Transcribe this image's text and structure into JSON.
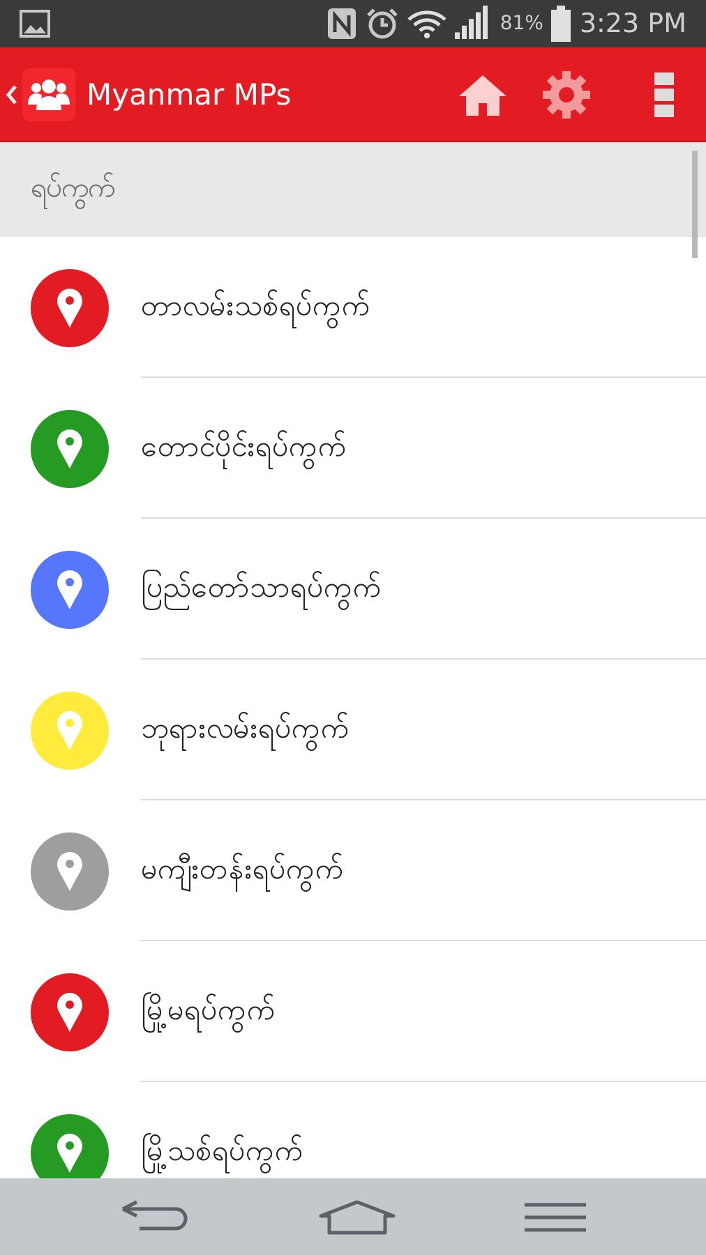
{
  "status_bar": {
    "battery": "81%",
    "time": "3:23 PM"
  },
  "app_bar": {
    "title": "Myanmar MPs"
  },
  "section_header": "ရပ်ကွက်",
  "items": [
    {
      "label": "တာလမ်းသစ်ရပ်ကွက်",
      "color": "#e31b23"
    },
    {
      "label": "တောင်ပိုင်းရပ်ကွက်",
      "color": "#259b24"
    },
    {
      "label": "ပြည်တော်သာရပ်ကွက်",
      "color": "#5677fc"
    },
    {
      "label": "ဘုရားလမ်းရပ်ကွက်",
      "color": "#ffeb3b"
    },
    {
      "label": "မကျီးတန်းရပ်ကွက်",
      "color": "#9e9e9e"
    },
    {
      "label": "မြို့မရပ်ကွက်",
      "color": "#e31b23"
    },
    {
      "label": "မြို့သစ်ရပ်ကွက်",
      "color": "#259b24"
    }
  ]
}
